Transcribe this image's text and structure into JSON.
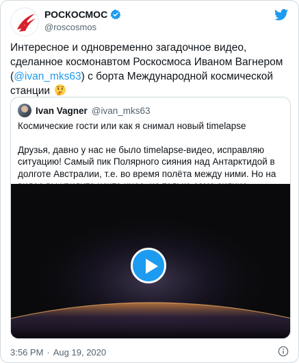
{
  "author": {
    "name": "РОСКОСМОС",
    "handle": "@roscosmos"
  },
  "tweet": {
    "text_before": "Интересное и одновременно загадочное видео, сделанное космонавтом Роскосмоса Иваном Вагнером (",
    "mention": "@ivan_mks63",
    "text_after": ") с борта Международной космической станции",
    "emoji": "thinking-face-emoji"
  },
  "quoted": {
    "name": "Ivan Vagner",
    "handle": "@ivan_mks63",
    "line1": "Космические гости или как я снимал новый timelapse",
    "paragraph": "Друзья, давно у нас не было timelapse-видео, исправляю ситуацию! Самый пик Полярного сияния над Антарктидой в долготе Австралии, т.е. во время полёта между ними. Но на видео вы увидите нечто иное, не только само сияние..."
  },
  "meta": {
    "time": "3:56 PM",
    "separator": "·",
    "date": "Aug 19, 2020"
  },
  "colors": {
    "accent": "#1d9bf0",
    "text": "#0f1419",
    "secondary": "#536471",
    "border": "#cfd9de",
    "video_bg": "#0a0a0c"
  },
  "icons": [
    "roscosmos-logo",
    "verified-badge-icon",
    "twitter-bird-icon",
    "play-icon",
    "info-icon"
  ]
}
